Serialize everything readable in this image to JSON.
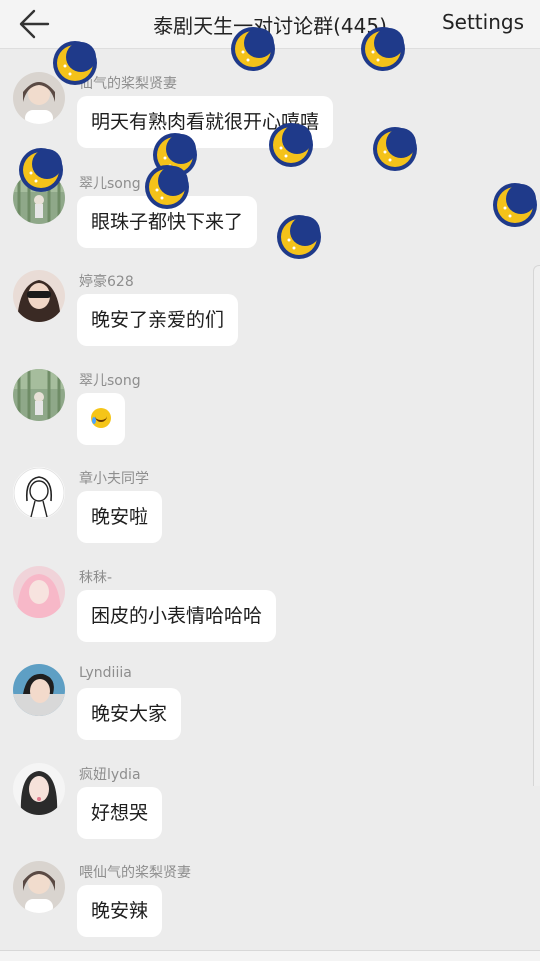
{
  "header": {
    "back_icon": "arrow-left-icon",
    "title": "泰剧天生一对讨论群(445)",
    "settings_label": "Settings"
  },
  "messages": [
    {
      "sender": "喂仙气的桨梨贤妻",
      "text": "明天有熟肉看就很开心嘻嘻",
      "visible_sender": "仙气的桨梨贤妻"
    },
    {
      "sender": "翠儿song",
      "text": "眼珠子都快下来了"
    },
    {
      "sender": "婷豪628",
      "text": "晚安了亲爱的们"
    },
    {
      "sender": "翠儿song",
      "text": "",
      "emoji": "laughing-crying-emoji"
    },
    {
      "sender": "章小夫同学",
      "text": "晚安啦"
    },
    {
      "sender": "秣秣-",
      "text": "困皮的小表情哈哈哈"
    },
    {
      "sender": "Lyndiiia",
      "text": "晚安大家"
    },
    {
      "sender": "疯妞lydia",
      "text": "好想哭"
    },
    {
      "sender": "喂仙气的桨梨贤妻",
      "text": "晚安辣"
    }
  ],
  "overlay": {
    "icon": "sleeping-moon-icon",
    "color": "#f4c21a"
  },
  "colors": {
    "background": "#ececec",
    "bubble": "#ffffff",
    "header": "#f4f4f4",
    "sender_text": "#8e8e8e"
  }
}
